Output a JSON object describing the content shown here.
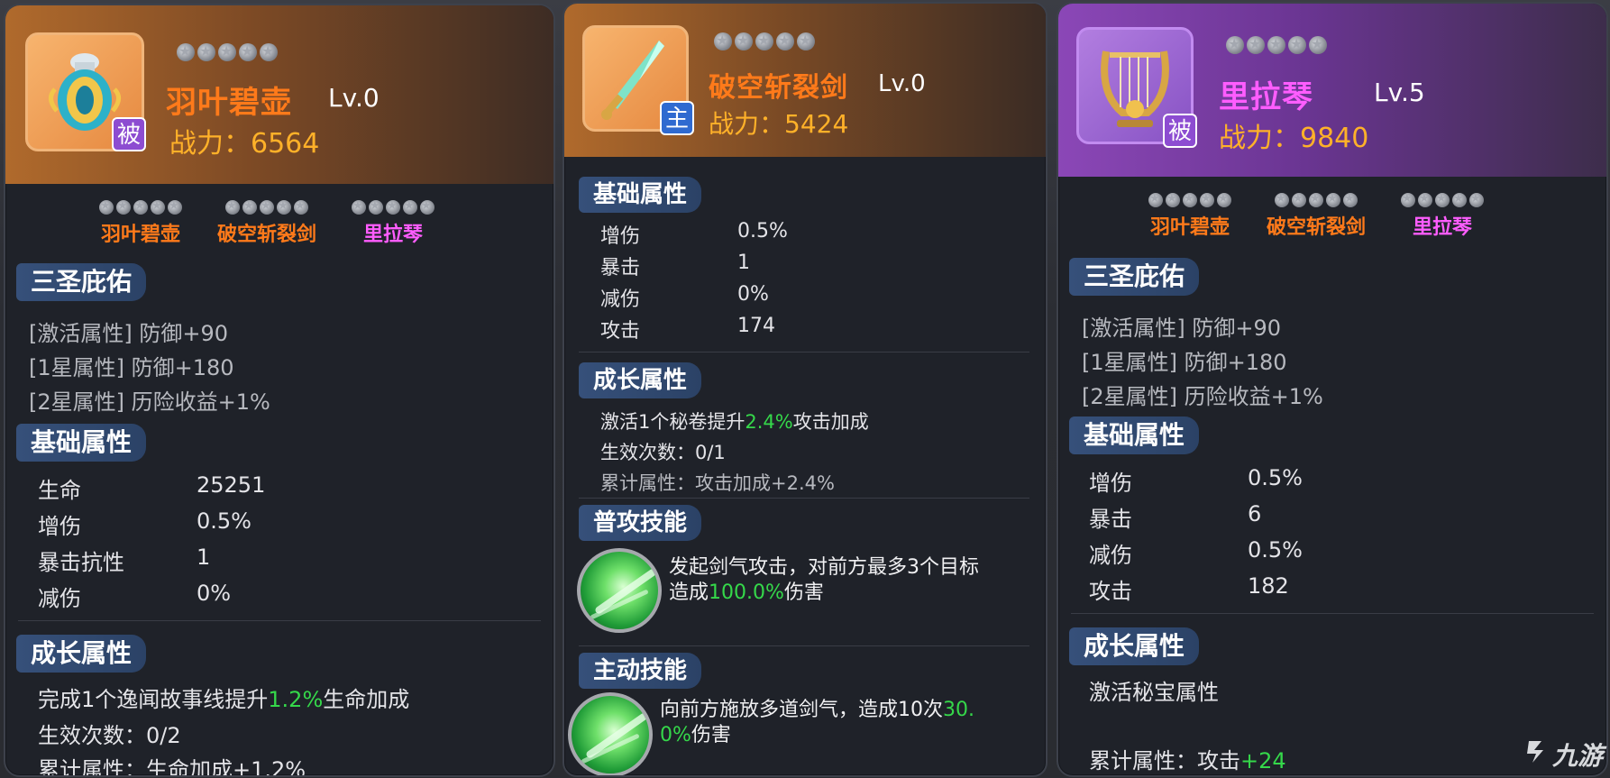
{
  "cards": [
    {
      "name": "羽叶碧壶",
      "level": "Lv.0",
      "power": "战力：6564",
      "tag": "被",
      "set_items": [
        {
          "name": "羽叶碧壶",
          "color": "orange"
        },
        {
          "name": "破空斩裂剑",
          "color": "orange"
        },
        {
          "name": "里拉琴",
          "color": "purple"
        }
      ],
      "trinity_title": "三圣庇佑",
      "trinity": [
        {
          "label": "[激活属性]",
          "value": "防御+90"
        },
        {
          "label": "[1星属性]",
          "value": "防御+180"
        },
        {
          "label": "[2星属性]",
          "value": "历险收益+1%"
        }
      ],
      "base_title": "基础属性",
      "base": [
        {
          "label": "生命",
          "value": "25251"
        },
        {
          "label": "增伤",
          "value": "0.5%"
        },
        {
          "label": "暴击抗性",
          "value": "1"
        },
        {
          "label": "减伤",
          "value": "0%"
        }
      ],
      "growth_title": "成长属性",
      "growth_line1_a": "完成1个逸闻故事线提升",
      "growth_line1_b": "1.2%",
      "growth_line1_c": "生命加成",
      "growth_count": "生效次数：0/2",
      "growth_total": "累计属性：生命加成+1.2%"
    },
    {
      "name": "破空斩裂剑",
      "level": "Lv.0",
      "power": "战力：5424",
      "tag": "主",
      "base_title": "基础属性",
      "base": [
        {
          "label": "增伤",
          "value": "0.5%"
        },
        {
          "label": "暴击",
          "value": "1"
        },
        {
          "label": "减伤",
          "value": "0%"
        },
        {
          "label": "攻击",
          "value": "174"
        }
      ],
      "growth_title": "成长属性",
      "growth_line1_a": "激活1个秘卷提升",
      "growth_line1_b": "2.4%",
      "growth_line1_c": "攻击加成",
      "growth_count": "生效次数：0/1",
      "growth_total": "累计属性：攻击加成+2.4%",
      "normal_skill_title": "普攻技能",
      "normal_skill_a": "发起剑气攻击，对前方最多3个目标",
      "normal_skill_b1": "造成",
      "normal_skill_b2": "100.0%",
      "normal_skill_b3": "伤害",
      "active_skill_title": "主动技能",
      "active_skill_a1": "向前方施放多道剑气，造成10次",
      "active_skill_a2": "30.",
      "active_skill_b1": "0%",
      "active_skill_b2": "伤害"
    },
    {
      "name": "里拉琴",
      "level": "Lv.5",
      "power": "战力：9840",
      "tag": "被",
      "set_items": [
        {
          "name": "羽叶碧壶",
          "color": "orange"
        },
        {
          "name": "破空斩裂剑",
          "color": "orange"
        },
        {
          "name": "里拉琴",
          "color": "purple"
        }
      ],
      "trinity_title": "三圣庇佑",
      "trinity": [
        {
          "label": "[激活属性]",
          "value": "防御+90"
        },
        {
          "label": "[1星属性]",
          "value": "防御+180"
        },
        {
          "label": "[2星属性]",
          "value": "历险收益+1%"
        }
      ],
      "base_title": "基础属性",
      "base": [
        {
          "label": "增伤",
          "value": "0.5%"
        },
        {
          "label": "暴击",
          "value": "6"
        },
        {
          "label": "减伤",
          "value": "0.5%"
        },
        {
          "label": "攻击",
          "value": "182"
        }
      ],
      "growth_title": "成长属性",
      "growth_line1": "激活秘宝属性",
      "growth_total_a": "累计属性：攻击",
      "growth_total_b": "+24"
    }
  ],
  "watermark": "九游",
  "colors": {
    "orange_quality": "#ff7a1a",
    "purple_quality": "#ff5dff",
    "power_gold": "#ffb129",
    "bonus_green": "#35d84a",
    "section_blue": "#36507a"
  }
}
